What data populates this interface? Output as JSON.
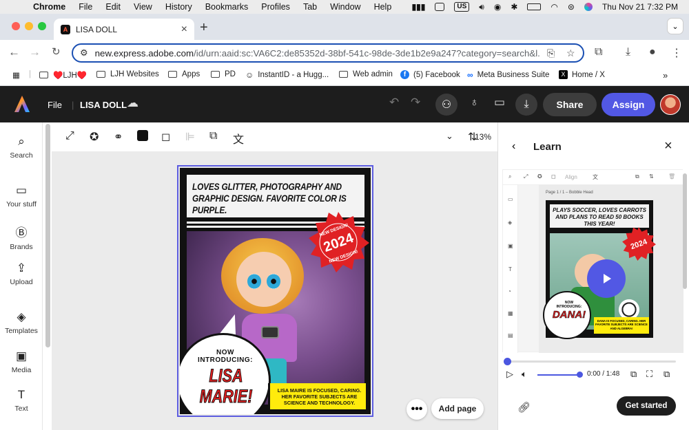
{
  "menubar": {
    "app": "Chrome",
    "items": [
      "File",
      "Edit",
      "View",
      "History",
      "Bookmarks",
      "Profiles",
      "Tab",
      "Window",
      "Help"
    ],
    "input_badge": "US",
    "datetime": "Thu Nov 21  7:32 PM"
  },
  "browser": {
    "tab_title": "LISA DOLL",
    "url_host": "new.express.adobe.com",
    "url_path": "/id/urn:aaid:sc:VA6C2:de85352d-38bf-541c-98de-3de1b2e9a247?category=search&l..."
  },
  "bookmarks": [
    {
      "label": "♥️LJH♥️",
      "icon": "folder-icon"
    },
    {
      "label": "LJH Websites",
      "icon": "folder-icon"
    },
    {
      "label": "Apps",
      "icon": "folder-icon"
    },
    {
      "label": "PD",
      "icon": "folder-icon"
    },
    {
      "label": "InstantID - a Hugg...",
      "icon": "hugging-face-icon"
    },
    {
      "label": "Web admin",
      "icon": "folder-icon"
    },
    {
      "label": "(5) Facebook",
      "icon": "facebook-icon"
    },
    {
      "label": "Meta Business Suite",
      "icon": "meta-icon"
    },
    {
      "label": "Home / X",
      "icon": "x-icon"
    }
  ],
  "express": {
    "file_menu": "File",
    "doc_title": "LISA DOLL",
    "share": "Share",
    "assign": "Assign",
    "accent": "#5258e4"
  },
  "rail": [
    {
      "label": "Search",
      "icon": "search-icon"
    },
    {
      "label": "Your stuff",
      "icon": "folder-icon"
    },
    {
      "label": "Brands",
      "icon": "brand-icon"
    },
    {
      "label": "Upload",
      "icon": "upload-icon"
    },
    {
      "label": "Templates",
      "icon": "templates-icon"
    },
    {
      "label": "Media",
      "icon": "media-icon"
    },
    {
      "label": "Text",
      "icon": "text-icon"
    }
  ],
  "toolbar": {
    "zoom": "13%"
  },
  "poster": {
    "headline": "LOVES GLITTER, PHOTOGRAPHY AND GRAPHIC DESIGN.  FAVORITE COLOR IS PURPLE.",
    "badge_year": "2024",
    "badge_ring": "NEW DESIGN!",
    "intro": "NOW INTRODUCING:",
    "name_line1": "LISA",
    "name_line2": "MARIE!",
    "caption": "LISA MAIRE IS FOCUSED, CARING. HER FAVORITE SUBJECTS ARE SCIENCE AND TECHNOLOGY."
  },
  "canvas": {
    "more": "•••",
    "add_page": "Add page"
  },
  "learn": {
    "title": "Learn",
    "video_page_label": "Page 1 / 1 – Bobble Head",
    "align_label": "Align",
    "mini_headline": "PLAYS SOCCER, LOVES CARROTS AND PLANS TO READ 50 BOOKS THIS YEAR!",
    "mini_intro": "NOW INTRODUCING:",
    "mini_name": "DANA!",
    "mini_caption": "DANA IS FOCUSED, CARING. HER FAVORITE SUBJECTS ARE SCIENCE AND ALGEBRA!",
    "mini_badge_year": "2024",
    "time": "0:00 / 1:48",
    "progress": 0,
    "volume": 1,
    "get_started": "Get started"
  }
}
